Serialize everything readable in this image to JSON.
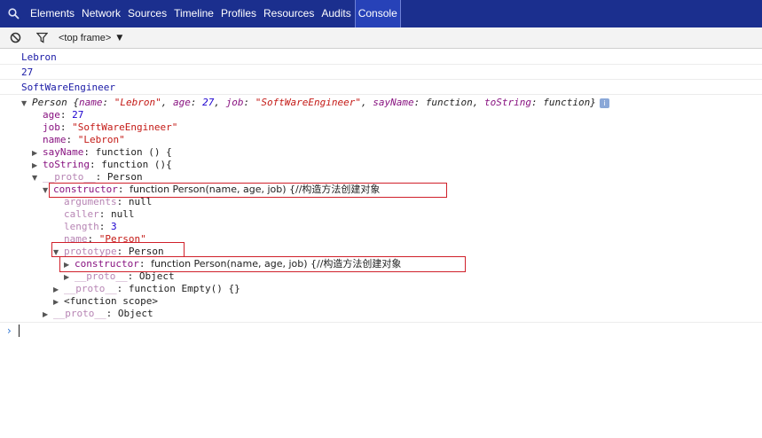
{
  "tabs": [
    {
      "label": "Elements"
    },
    {
      "label": "Network"
    },
    {
      "label": "Sources"
    },
    {
      "label": "Timeline"
    },
    {
      "label": "Profiles"
    },
    {
      "label": "Resources"
    },
    {
      "label": "Audits"
    },
    {
      "label": "Console"
    }
  ],
  "active_tab": "Console",
  "filter": {
    "frame_label": "<top frame>",
    "clear_icon": "no-entry-icon",
    "filter_icon": "funnel-icon"
  },
  "messages": [
    "Lebron",
    "27",
    "SoftWareEngineer"
  ],
  "tree": {
    "root": {
      "cls": "Person",
      "summary_open": " {",
      "s_name_k": "name",
      "s_name_v": "\"Lebron\"",
      "s_age_k": "age",
      "s_age_v": "27",
      "s_job_k": "job",
      "s_job_v": "\"SoftWareEngineer\"",
      "s_say_k": "sayName",
      "s_say_v": "function",
      "s_tostr_k": "toString",
      "s_tostr_v": "function",
      "summary_close": "}",
      "info_icon": "i"
    },
    "age": {
      "k": "age",
      "v": "27"
    },
    "job": {
      "k": "job",
      "v": "\"SoftWareEngineer\""
    },
    "name": {
      "k": "name",
      "v": "\"Lebron\""
    },
    "sayName": {
      "k": "sayName",
      "v": "function () {"
    },
    "toString": {
      "k": "toString",
      "v": "function (){"
    },
    "proto1": {
      "k": "__proto__",
      "v": "Person"
    },
    "constructor1": {
      "k": "constructor",
      "v": "function Person(name, age, job) {//构造方法创建对象"
    },
    "arguments": {
      "k": "arguments",
      "v": "null"
    },
    "caller": {
      "k": "caller",
      "v": "null"
    },
    "length": {
      "k": "length",
      "v": "3"
    },
    "cname": {
      "k": "name",
      "v": "\"Person\""
    },
    "prototype": {
      "k": "prototype",
      "v": "Person"
    },
    "constructor2": {
      "k": "constructor",
      "v": "function Person(name, age, job) {//构造方法创建对象"
    },
    "proto2": {
      "k": "__proto__",
      "v": "Object"
    },
    "proto3": {
      "k": "__proto__",
      "v": "function Empty() {}"
    },
    "scope": {
      "k": "<function scope>"
    },
    "proto4": {
      "k": "__proto__",
      "v": "Object"
    }
  },
  "prompt_glyph": "›",
  "colors": {
    "tabbar": "#1b2f8e",
    "highlight": "#d0202a",
    "property": "#881280",
    "string": "#c41a16",
    "number": "#1c00cf"
  }
}
